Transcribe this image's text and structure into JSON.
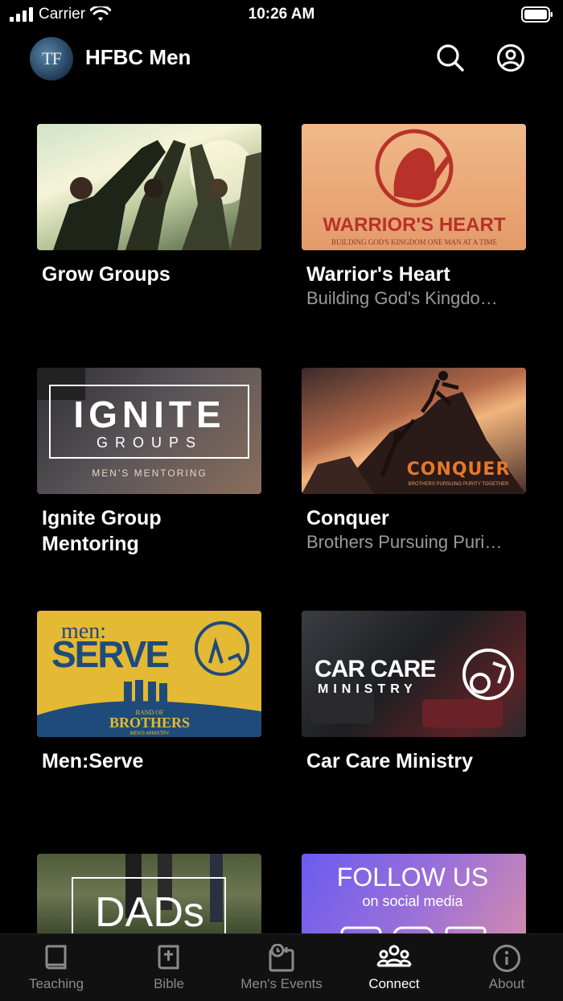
{
  "status_bar": {
    "carrier": "Carrier",
    "time": "10:26 AM"
  },
  "header": {
    "logo_text": "TF",
    "title": "HFBC Men",
    "icons": {
      "search": "search-icon",
      "profile": "user-circle-icon"
    }
  },
  "cards": [
    {
      "title": "Grow Groups",
      "subtitle": ""
    },
    {
      "title": "Warrior's Heart",
      "subtitle": "Building God's Kingdo…",
      "image_text": {
        "heading": "WARRIOR'S HEART",
        "tagline": "BUILDING GOD'S KINGDOM ONE MAN AT A TIME"
      }
    },
    {
      "title": "Ignite Group Mentoring",
      "subtitle": "",
      "image_text": {
        "heading": "IGNITE",
        "sub": "GROUPS",
        "tagline": "MEN'S MENTORING"
      }
    },
    {
      "title": "Conquer",
      "subtitle": "Brothers Pursuing Puri…",
      "image_text": {
        "heading": "CONQUER",
        "tagline": "BROTHERS PURSUING PURITY TOGETHER"
      }
    },
    {
      "title": "Men:Serve",
      "subtitle": "",
      "image_text": {
        "pre": "men:",
        "heading": "SERVE",
        "brand_top": "BAND OF",
        "brand": "BROTHERS",
        "brand_sub": "MEN'S MINISTRY"
      }
    },
    {
      "title": "Car Care Ministry",
      "subtitle": "",
      "image_text": {
        "heading": "CAR CARE",
        "sub": "MINISTRY"
      }
    },
    {
      "title": "",
      "subtitle": "",
      "image_text": {
        "heading": "DADs"
      }
    },
    {
      "title": "",
      "subtitle": "",
      "image_text": {
        "heading": "FOLLOW US",
        "sub": "on social media"
      }
    }
  ],
  "tabs": [
    {
      "label": "Teaching",
      "icon": "book-icon",
      "active": false
    },
    {
      "label": "Bible",
      "icon": "bible-icon",
      "active": false
    },
    {
      "label": "Men's Events",
      "icon": "calendar-icon",
      "active": false
    },
    {
      "label": "Connect",
      "icon": "people-icon",
      "active": true
    },
    {
      "label": "About",
      "icon": "info-icon",
      "active": false
    }
  ],
  "colors": {
    "background": "#000000",
    "subtitle": "#9a9a9a",
    "tab_inactive": "#8a8a8a",
    "tab_active": "#ffffff"
  }
}
